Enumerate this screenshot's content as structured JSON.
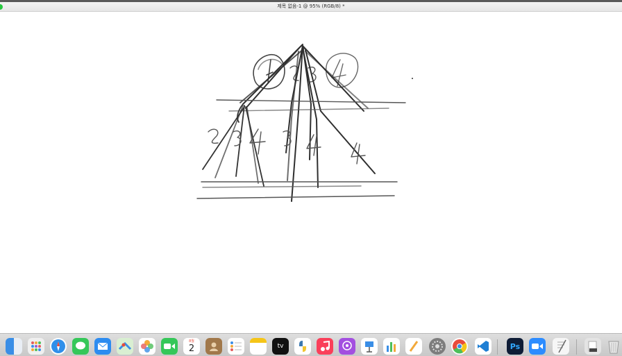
{
  "window": {
    "title": "제목 없음-1 @ 95% (RGB/8) *"
  },
  "colors": {
    "stroke": "#333333",
    "window_green": "#28c840"
  },
  "canvas": {
    "content": "handwritten sketch"
  },
  "dock": {
    "apps": [
      {
        "name": "Finder",
        "icon": "finder-icon"
      },
      {
        "name": "Launchpad",
        "icon": "launchpad-icon"
      },
      {
        "name": "Safari",
        "icon": "safari-icon"
      },
      {
        "name": "Messages",
        "icon": "messages-icon"
      },
      {
        "name": "Mail",
        "icon": "mail-icon"
      },
      {
        "name": "Maps",
        "icon": "maps-icon"
      },
      {
        "name": "Photos",
        "icon": "photos-icon"
      },
      {
        "name": "FaceTime",
        "icon": "facetime-icon"
      },
      {
        "name": "Calendar",
        "icon": "calendar-icon",
        "month": "8월",
        "day": "2"
      },
      {
        "name": "Contacts",
        "icon": "contacts-icon"
      },
      {
        "name": "Reminders",
        "icon": "reminders-icon"
      },
      {
        "name": "Notes",
        "icon": "notes-icon"
      },
      {
        "name": "Apple TV",
        "icon": "appletv-icon",
        "label": "tv"
      },
      {
        "name": "Python",
        "icon": "python-icon"
      },
      {
        "name": "Music",
        "icon": "music-icon"
      },
      {
        "name": "Podcasts",
        "icon": "podcasts-icon"
      },
      {
        "name": "Keynote",
        "icon": "keynote-icon"
      },
      {
        "name": "Numbers",
        "icon": "numbers-icon"
      },
      {
        "name": "Pages",
        "icon": "pages-icon"
      },
      {
        "name": "System Preferences",
        "icon": "system-preferences-icon"
      },
      {
        "name": "Chrome",
        "icon": "chrome-icon"
      },
      {
        "name": "VS Code",
        "icon": "vscode-icon"
      },
      {
        "name": "Photoshop",
        "icon": "photoshop-icon",
        "label": "Ps"
      },
      {
        "name": "Zoom",
        "icon": "zoom-icon"
      },
      {
        "name": "TextEdit",
        "icon": "textedit-icon"
      },
      {
        "name": "Documents",
        "icon": "documents-folder-icon"
      },
      {
        "name": "Trash",
        "icon": "trash-icon"
      }
    ]
  }
}
